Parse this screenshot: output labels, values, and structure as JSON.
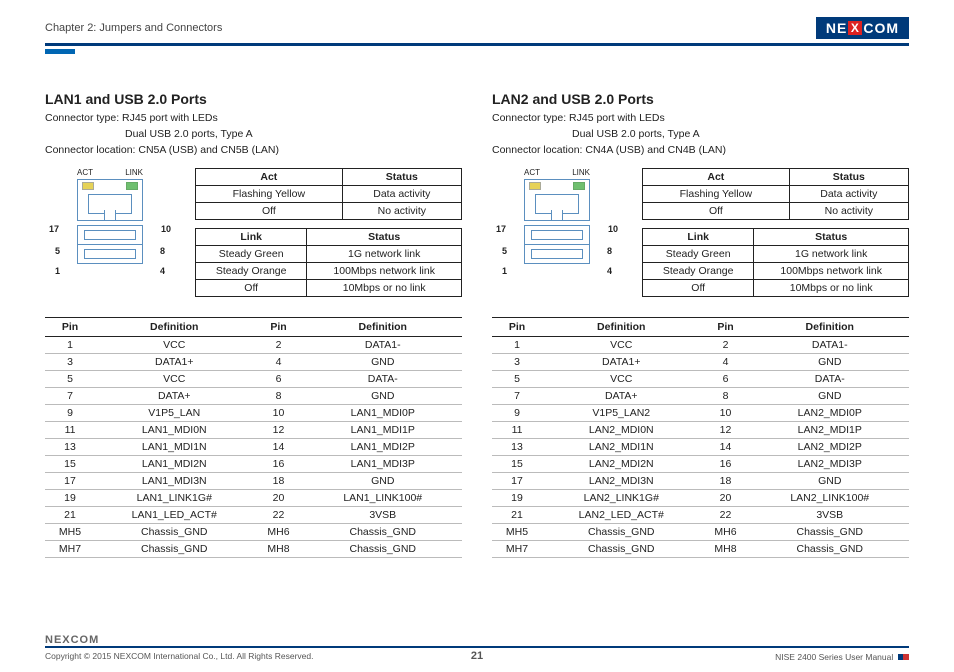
{
  "header": {
    "chapter": "Chapter 2: Jumpers and Connectors",
    "logo_text_pre": "NE",
    "logo_text_x": "X",
    "logo_text_post": "COM"
  },
  "sections": [
    {
      "title": "LAN1 and USB 2.0 Ports",
      "meta_line1": "Connector type: RJ45 port with LEDs",
      "meta_line2": "Dual USB 2.0 ports, Type A",
      "meta_line3": "Connector location: CN5A (USB) and CN5B (LAN)",
      "diagram": {
        "act_label": "ACT",
        "link_label": "LINK",
        "pins": {
          "l17": "17",
          "r10": "10",
          "l5": "5",
          "r8": "8",
          "l1": "1",
          "r4": "4"
        }
      },
      "act_table": {
        "headers": [
          "Act",
          "Status"
        ],
        "rows": [
          [
            "Flashing Yellow",
            "Data activity"
          ],
          [
            "Off",
            "No activity"
          ]
        ]
      },
      "link_table": {
        "headers": [
          "Link",
          "Status"
        ],
        "rows": [
          [
            "Steady Green",
            "1G network link"
          ],
          [
            "Steady Orange",
            "100Mbps network link"
          ],
          [
            "Off",
            "10Mbps or no link"
          ]
        ]
      },
      "pins_table": {
        "headers": [
          "Pin",
          "Definition",
          "Pin",
          "Definition"
        ],
        "rows": [
          [
            "1",
            "VCC",
            "2",
            "DATA1-"
          ],
          [
            "3",
            "DATA1+",
            "4",
            "GND"
          ],
          [
            "5",
            "VCC",
            "6",
            "DATA-"
          ],
          [
            "7",
            "DATA+",
            "8",
            "GND"
          ],
          [
            "9",
            "V1P5_LAN",
            "10",
            "LAN1_MDI0P"
          ],
          [
            "11",
            "LAN1_MDI0N",
            "12",
            "LAN1_MDI1P"
          ],
          [
            "13",
            "LAN1_MDI1N",
            "14",
            "LAN1_MDI2P"
          ],
          [
            "15",
            "LAN1_MDI2N",
            "16",
            "LAN1_MDI3P"
          ],
          [
            "17",
            "LAN1_MDI3N",
            "18",
            "GND"
          ],
          [
            "19",
            "LAN1_LINK1G#",
            "20",
            "LAN1_LINK100#"
          ],
          [
            "21",
            "LAN1_LED_ACT#",
            "22",
            "3VSB"
          ],
          [
            "MH5",
            "Chassis_GND",
            "MH6",
            "Chassis_GND"
          ],
          [
            "MH7",
            "Chassis_GND",
            "MH8",
            "Chassis_GND"
          ]
        ]
      }
    },
    {
      "title": "LAN2 and USB 2.0 Ports",
      "meta_line1": "Connector type: RJ45 port with LEDs",
      "meta_line2": "Dual USB 2.0 ports, Type A",
      "meta_line3": "Connector location: CN4A (USB) and CN4B (LAN)",
      "diagram": {
        "act_label": "ACT",
        "link_label": "LINK",
        "pins": {
          "l17": "17",
          "r10": "10",
          "l5": "5",
          "r8": "8",
          "l1": "1",
          "r4": "4"
        }
      },
      "act_table": {
        "headers": [
          "Act",
          "Status"
        ],
        "rows": [
          [
            "Flashing Yellow",
            "Data activity"
          ],
          [
            "Off",
            "No activity"
          ]
        ]
      },
      "link_table": {
        "headers": [
          "Link",
          "Status"
        ],
        "rows": [
          [
            "Steady Green",
            "1G network link"
          ],
          [
            "Steady Orange",
            "100Mbps network link"
          ],
          [
            "Off",
            "10Mbps or no link"
          ]
        ]
      },
      "pins_table": {
        "headers": [
          "Pin",
          "Definition",
          "Pin",
          "Definition"
        ],
        "rows": [
          [
            "1",
            "VCC",
            "2",
            "DATA1-"
          ],
          [
            "3",
            "DATA1+",
            "4",
            "GND"
          ],
          [
            "5",
            "VCC",
            "6",
            "DATA-"
          ],
          [
            "7",
            "DATA+",
            "8",
            "GND"
          ],
          [
            "9",
            "V1P5_LAN2",
            "10",
            "LAN2_MDI0P"
          ],
          [
            "11",
            "LAN2_MDI0N",
            "12",
            "LAN2_MDI1P"
          ],
          [
            "13",
            "LAN2_MDI1N",
            "14",
            "LAN2_MDI2P"
          ],
          [
            "15",
            "LAN2_MDI2N",
            "16",
            "LAN2_MDI3P"
          ],
          [
            "17",
            "LAN2_MDI3N",
            "18",
            "GND"
          ],
          [
            "19",
            "LAN2_LINK1G#",
            "20",
            "LAN2_LINK100#"
          ],
          [
            "21",
            "LAN2_LED_ACT#",
            "22",
            "3VSB"
          ],
          [
            "MH5",
            "Chassis_GND",
            "MH6",
            "Chassis_GND"
          ],
          [
            "MH7",
            "Chassis_GND",
            "MH8",
            "Chassis_GND"
          ]
        ]
      }
    }
  ],
  "footer": {
    "logo": "NEXCOM",
    "copyright": "Copyright © 2015 NEXCOM International Co., Ltd. All Rights Reserved.",
    "page": "21",
    "manual": "NISE 2400 Series User Manual"
  }
}
